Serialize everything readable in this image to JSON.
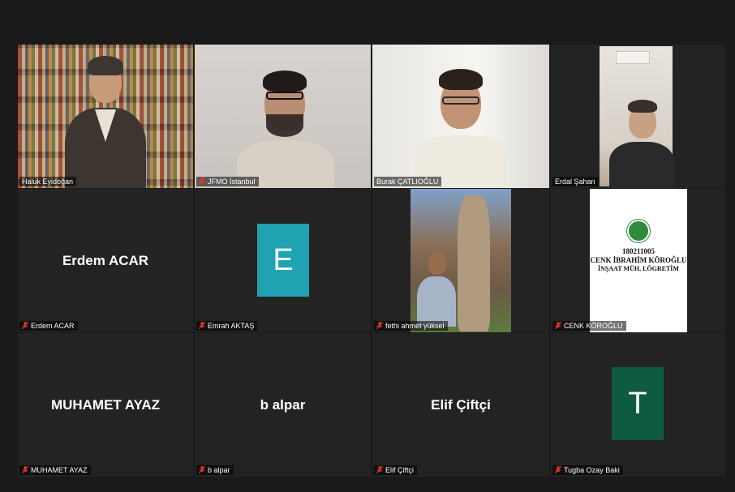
{
  "meeting": {
    "participants": [
      {
        "display_name": "Haluk Eyidoğan",
        "muted": false,
        "video": true,
        "active_speaker": false
      },
      {
        "display_name": "JFMO İstanbul",
        "muted": true,
        "video": true,
        "active_speaker": false
      },
      {
        "display_name": "Burak ÇATLIOĞLU",
        "muted": false,
        "video": true,
        "active_speaker": true
      },
      {
        "display_name": "Erdal Şahan",
        "muted": false,
        "video": true,
        "active_speaker": false
      },
      {
        "display_name": "Erdem ACAR",
        "big_label": "Erdem ACAR",
        "muted": true,
        "video": false
      },
      {
        "display_name": "Emrah AKTAŞ",
        "avatar_letter": "E",
        "avatar_color": "#1fa3b3",
        "muted": true,
        "video": false
      },
      {
        "display_name": "fethi ahmet yüksel",
        "muted": true,
        "video": true
      },
      {
        "display_name": "CENK KÖROĞLU",
        "muted": true,
        "video": true,
        "card_lines": [
          "180211005",
          "CENK İBRAHİM KÖROĞLU",
          "İNŞAAT MÜH. LÖGRETİM"
        ]
      },
      {
        "display_name": "MUHAMET AYAZ",
        "big_label": "MUHAMET AYAZ",
        "muted": true,
        "video": false
      },
      {
        "display_name": "b alpar",
        "big_label": "b alpar",
        "muted": true,
        "video": false
      },
      {
        "display_name": "Elif Çiftçi",
        "big_label": "Elif Çiftçi",
        "muted": true,
        "video": false
      },
      {
        "display_name": "Tugba Ozay Baki",
        "avatar_letter": "T",
        "avatar_color": "#0f5a42",
        "muted": true,
        "video": false
      }
    ]
  },
  "colors": {
    "background": "#1a1a1a",
    "tile": "#232323",
    "active_border": "#d6dd6a",
    "muted_icon": "#e0362c"
  },
  "icons": {
    "muted": "muted-microphone-icon"
  }
}
